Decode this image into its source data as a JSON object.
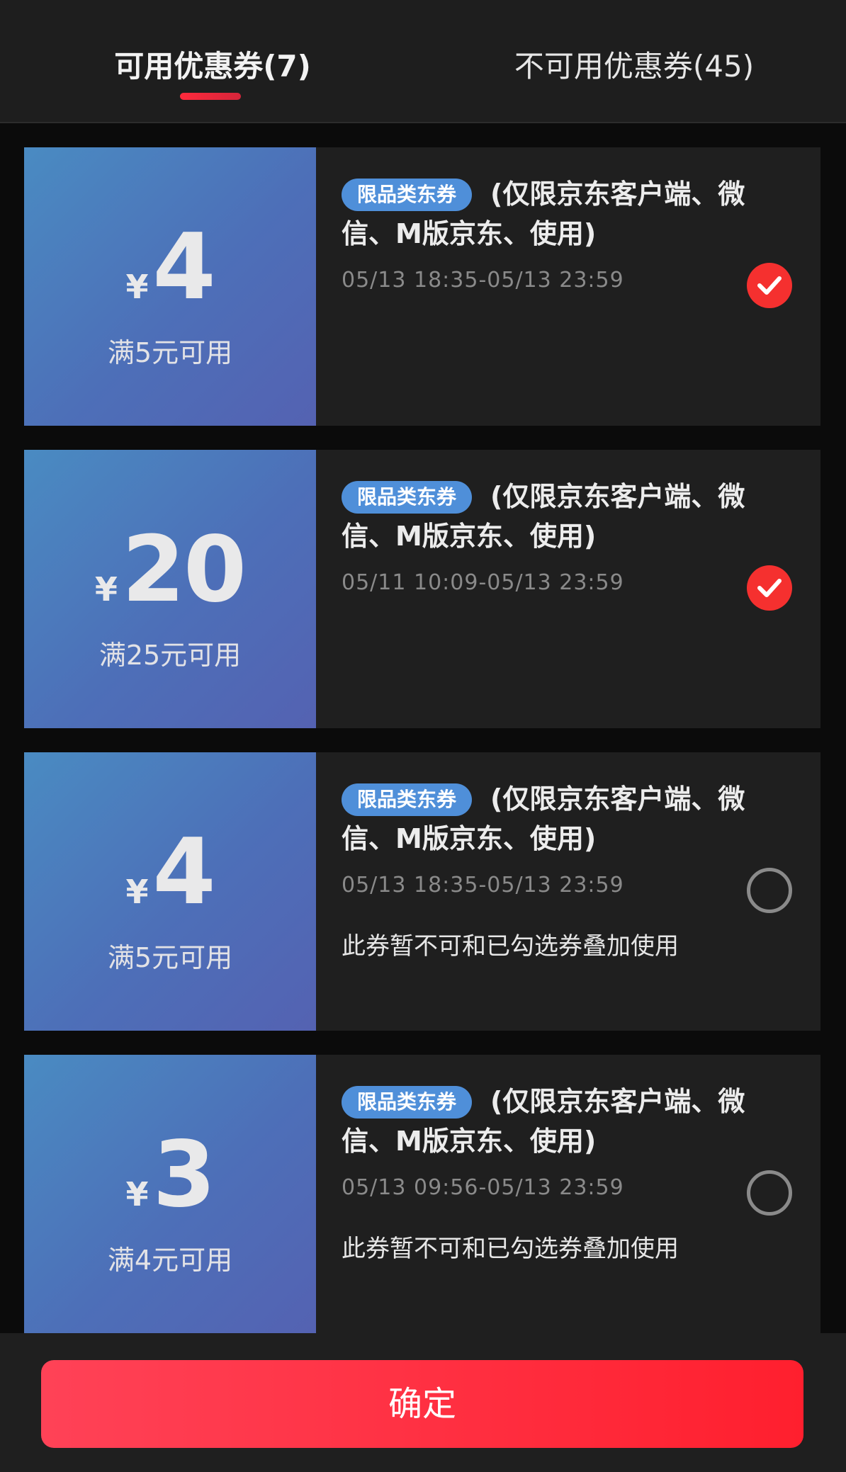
{
  "tabs": {
    "available": "可用优惠券(7)",
    "unavailable": "不可用优惠券(45)"
  },
  "currency_symbol": "¥",
  "coupons": [
    {
      "amount": "4",
      "threshold": "满5元可用",
      "badge": "限品类东券",
      "title": "(仅限京东客户端、微信、M版京东、使用)",
      "validity": "05/13 18:35-05/13 23:59",
      "notice": "",
      "selected": true
    },
    {
      "amount": "20",
      "threshold": "满25元可用",
      "badge": "限品类东券",
      "title": "(仅限京东客户端、微信、M版京东、使用)",
      "validity": "05/11 10:09-05/13 23:59",
      "notice": "",
      "selected": true
    },
    {
      "amount": "4",
      "threshold": "满5元可用",
      "badge": "限品类东券",
      "title": "(仅限京东客户端、微信、M版京东、使用)",
      "validity": "05/13 18:35-05/13 23:59",
      "notice": "此券暂不可和已勾选券叠加使用",
      "selected": false
    },
    {
      "amount": "3",
      "threshold": "满4元可用",
      "badge": "限品类东券",
      "title": "(仅限京东客户端、微信、M版京东、使用)",
      "validity": "05/13 09:56-05/13 23:59",
      "notice": "此券暂不可和已勾选券叠加使用",
      "selected": false
    }
  ],
  "footer": {
    "confirm_label": "确定"
  },
  "colors": {
    "accent": "#f5302f",
    "badge": "#4f8fd9",
    "coupon_gradient_start": "#4a8bc2",
    "coupon_gradient_end": "#5462b2"
  }
}
